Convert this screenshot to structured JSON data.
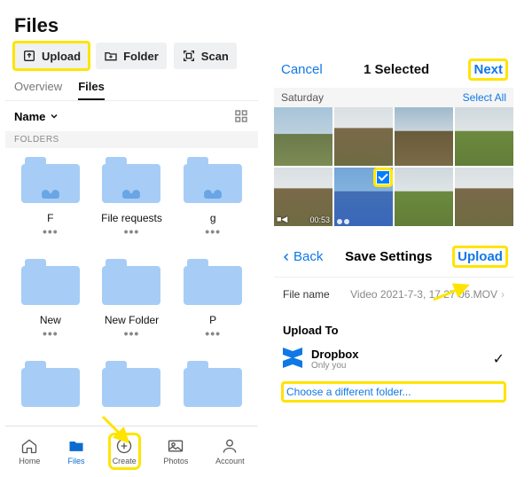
{
  "left": {
    "title": "Files",
    "actions": {
      "upload": "Upload",
      "folder": "Folder",
      "scan": "Scan"
    },
    "tabs": {
      "overview": "Overview",
      "files": "Files"
    },
    "sort_label": "Name",
    "section": "FOLDERS",
    "folders": [
      {
        "name": "F",
        "shared": true
      },
      {
        "name": "File requests",
        "shared": true
      },
      {
        "name": "g",
        "shared": true
      },
      {
        "name": "New",
        "shared": false
      },
      {
        "name": "New Folder",
        "shared": false
      },
      {
        "name": "P",
        "shared": false
      },
      {
        "name": "",
        "shared": false
      },
      {
        "name": "",
        "shared": false
      },
      {
        "name": "",
        "shared": false
      }
    ],
    "tabbar": {
      "home": "Home",
      "files": "Files",
      "create": "Create",
      "photos": "Photos",
      "account": "Account"
    }
  },
  "right": {
    "picker": {
      "cancel": "Cancel",
      "title": "1 Selected",
      "next": "Next",
      "day": "Saturday",
      "select_all": "Select All",
      "video_duration": "00:53"
    },
    "save": {
      "back": "Back",
      "title": "Save Settings",
      "upload": "Upload",
      "filename_key": "File name",
      "filename_val": "Video 2021-7-3, 17 27 06.MOV",
      "upload_to": "Upload To",
      "dest_name": "Dropbox",
      "dest_sub": "Only you",
      "choose_diff": "Choose a different folder..."
    }
  }
}
